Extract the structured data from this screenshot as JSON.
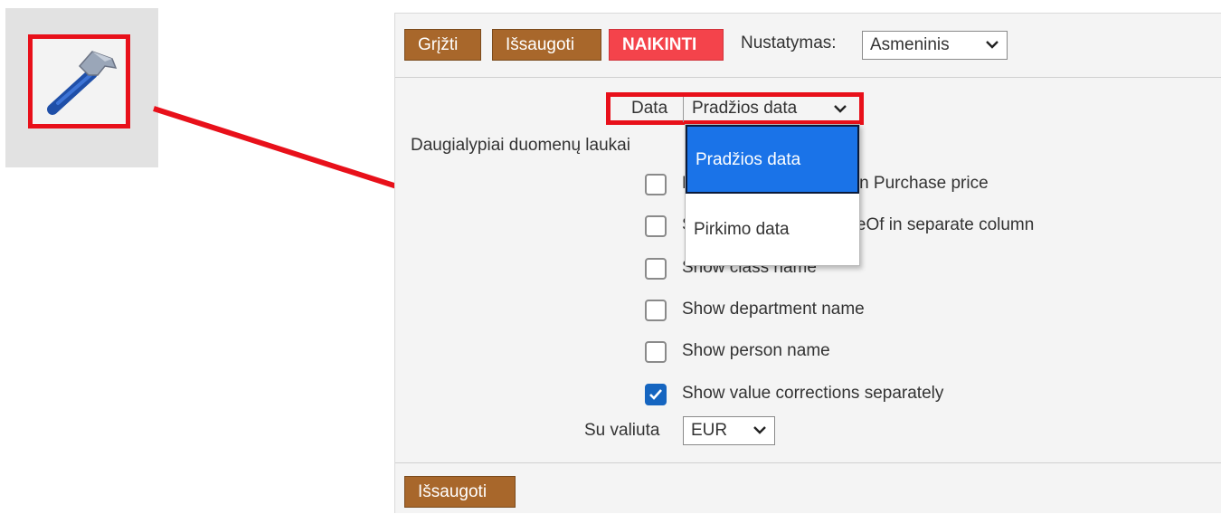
{
  "icons": {
    "tool_icon": "hammer-icon"
  },
  "toolbar": {
    "back_label": "Grįžti",
    "save_label": "Išsaugoti",
    "delete_label": "NAIKINTI",
    "preset_label": "Nustatymas:",
    "preset_value": "Asmeninis"
  },
  "form": {
    "date_label": "Data",
    "date_value": "Pradžios data",
    "multi_label": "Daugialypiai duomenų laukai",
    "checkboxes": [
      {
        "label": "Do not include writoffs in Purchase price",
        "checked": false
      },
      {
        "label": "Show Discard and WriteOf in separate column",
        "checked": false
      },
      {
        "label": "Show class name",
        "checked": false
      },
      {
        "label": "Show department name",
        "checked": false
      },
      {
        "label": "Show person name",
        "checked": false
      },
      {
        "label": "Show value corrections separately",
        "checked": true
      }
    ],
    "currency_label": "Su valiuta",
    "currency_value": "EUR"
  },
  "dropdown": {
    "options": [
      "Pradžios data",
      "Pirkimo data"
    ],
    "selected": "Pradžios data"
  },
  "footer": {
    "save_label": "Išsaugoti"
  },
  "colors": {
    "brown_button": "#a8672b",
    "red_button": "#f4434b",
    "highlight_red": "#e8101a",
    "selected_blue": "#1a73e8",
    "checkbox_blue": "#1565c0"
  }
}
